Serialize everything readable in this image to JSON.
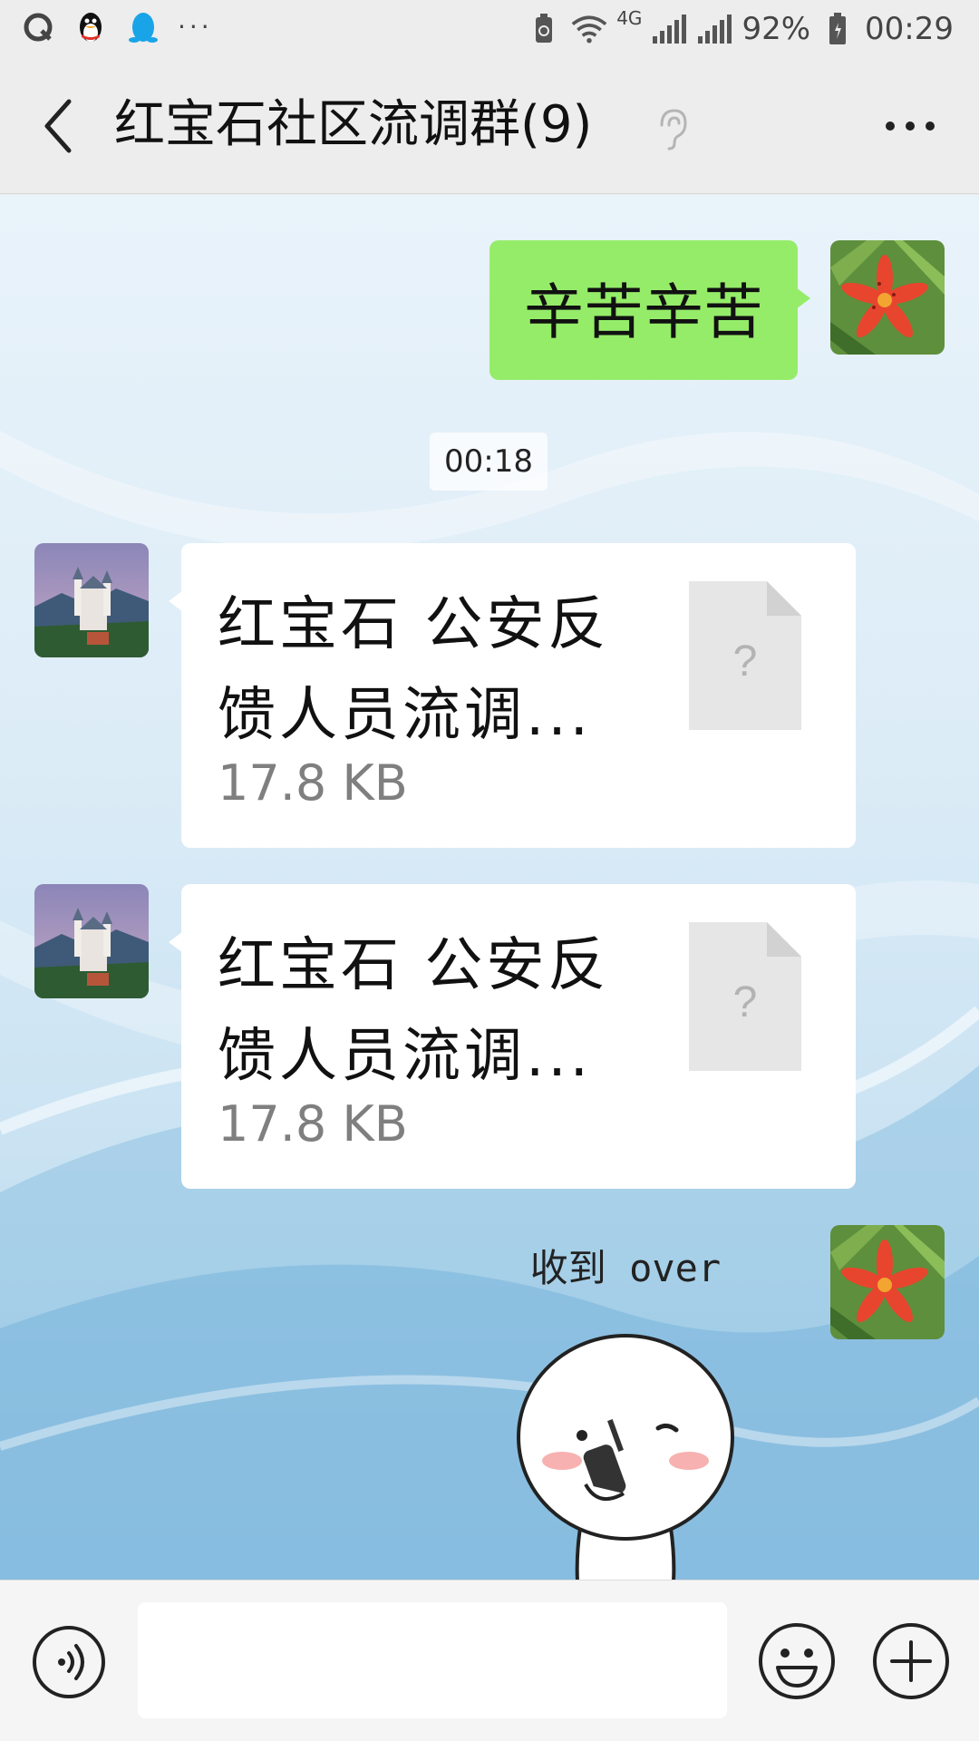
{
  "status_bar": {
    "battery": "92%",
    "time": "00:29",
    "network": "4G",
    "overflow_label": "···"
  },
  "header": {
    "title": "红宝石社区流调群(9)"
  },
  "messages": [
    {
      "type": "text",
      "direction": "outgoing",
      "text": "辛苦辛苦"
    },
    {
      "type": "time",
      "text": "00:18"
    },
    {
      "type": "file",
      "direction": "incoming",
      "name": "红宝石 公安反馈人员流调...",
      "size": "17.8 KB"
    },
    {
      "type": "file",
      "direction": "incoming",
      "name": "红宝石 公安反馈人员流调...",
      "size": "17.8 KB"
    },
    {
      "type": "sticker",
      "direction": "outgoing",
      "caption": "收到 over"
    }
  ],
  "input": {
    "value": "",
    "placeholder": ""
  },
  "colors": {
    "outgoing_bubble": "#95ec69",
    "incoming_bubble": "#ffffff",
    "header_bg": "#ededed"
  },
  "icons": [
    "back-arrow-icon",
    "ear-icon",
    "more-icon",
    "voice-icon",
    "emoji-icon",
    "plus-icon"
  ]
}
